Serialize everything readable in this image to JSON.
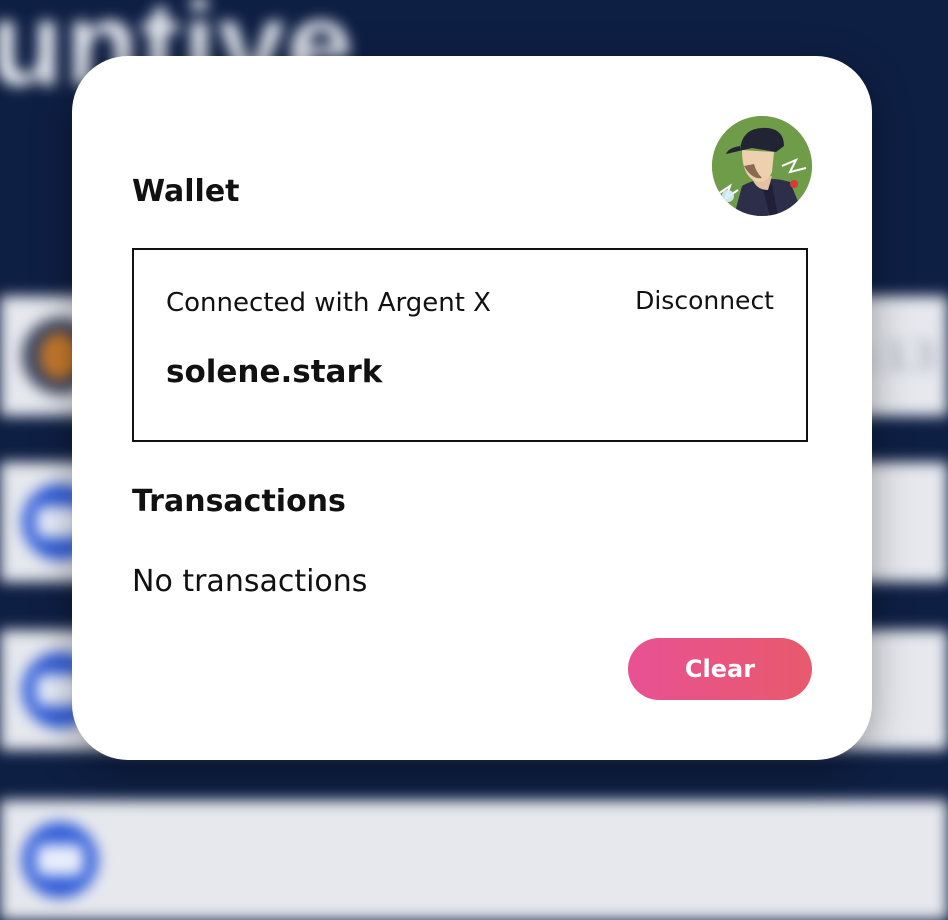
{
  "background": {
    "app_title": "untive",
    "rows": [
      {
        "avatar": "orange-avatar",
        "value": "1:13"
      },
      {
        "avatar": "blue-avatar",
        "value": ""
      },
      {
        "avatar": "blue-avatar",
        "value": ""
      }
    ]
  },
  "modal": {
    "avatar": "user-avatar-icon",
    "wallet_title": "Wallet",
    "connected_text": "Connected with Argent X",
    "disconnect_label": "Disconnect",
    "account_name": "solene.stark",
    "transactions_title": "Transactions",
    "no_transactions_text": "No transactions",
    "clear_label": "Clear"
  },
  "colors": {
    "background": "#0e1f44",
    "modal": "#ffffff",
    "clear_gradient_start": "#e85193",
    "clear_gradient_end": "#e85a6c"
  }
}
